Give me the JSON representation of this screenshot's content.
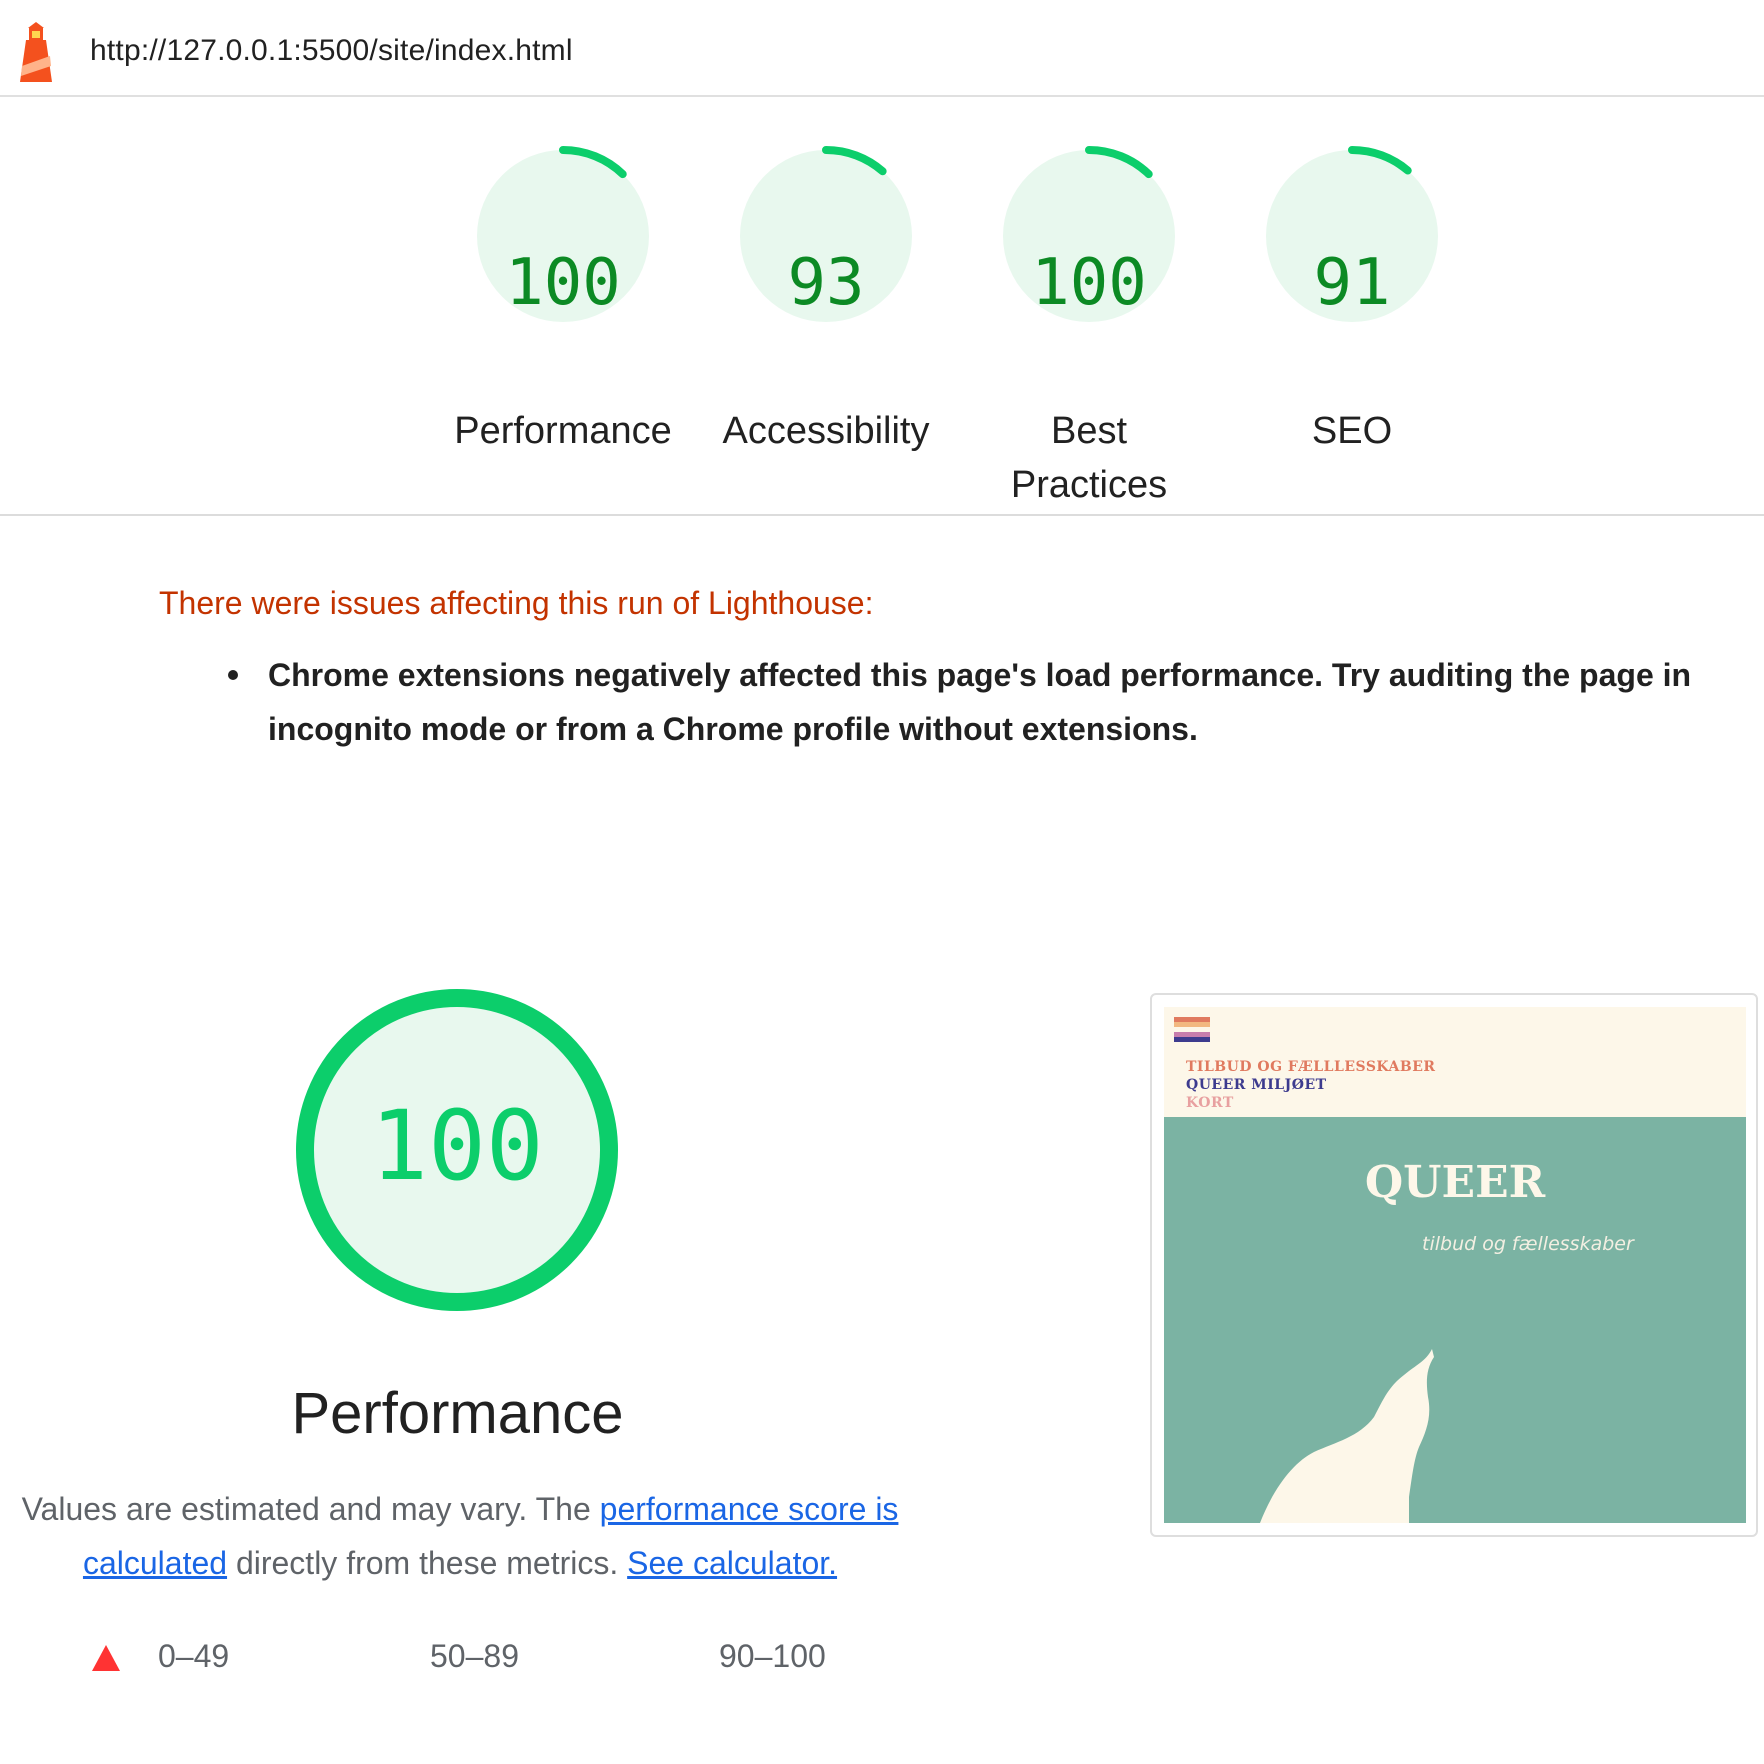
{
  "header": {
    "url": "http://127.0.0.1:5500/site/index.html",
    "logo_icon": "lighthouse-icon"
  },
  "categories": [
    {
      "score": "100",
      "label": "Performance",
      "value": 100
    },
    {
      "score": "93",
      "label": "Accessibility",
      "value": 93
    },
    {
      "score": "100",
      "label": "Best Practices",
      "value": 100
    },
    {
      "score": "91",
      "label": "SEO",
      "value": 91
    }
  ],
  "warning": {
    "title": "There were issues affecting this run of Lighthouse:",
    "items": [
      "Chrome extensions negatively affected this page's load performance. Try auditing the page in incognito mode or from a Chrome profile without extensions."
    ]
  },
  "performance": {
    "score": "100",
    "value": 100,
    "label": "Performance",
    "desc_prefix": "Values are estimated and may vary. The ",
    "link_score": "performance score is calculated",
    "desc_middle": " directly from these metrics. ",
    "link_calc": "See calculator."
  },
  "legend": {
    "fail": "0–49",
    "average": "50–89",
    "pass": "90–100"
  },
  "screenshot": {
    "nav": [
      "TILBUD OG FÆLLLESSKABER",
      "QUEER MILJØET",
      "KORT"
    ],
    "title": "QUEER",
    "subtitle": "tilbud og fællesskaber"
  },
  "colors": {
    "pass": "#0cce6b",
    "pass_text": "#0c8a24",
    "pass_bg": "#e8f8ee",
    "warn": "#c33300",
    "link": "#1a66e5",
    "fail": "#ff3333"
  }
}
